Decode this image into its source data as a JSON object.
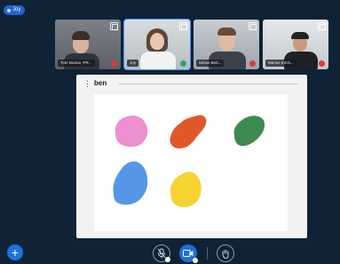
{
  "self_badge": {
    "label": "Joy"
  },
  "participants": [
    {
      "name": "Tom Dunne, PR...",
      "mic": "muted",
      "active": false
    },
    {
      "name": "Joy",
      "mic": "on",
      "active": true
    },
    {
      "name": "Niklas Berl...",
      "mic": "muted",
      "active": false
    },
    {
      "name": "Marius Kirch...",
      "mic": "muted",
      "active": false
    }
  ],
  "document": {
    "title": "ben",
    "menu_icon": "kebab-menu-icon",
    "shapes": [
      {
        "label": "pink blob",
        "color": "#ee8fd0"
      },
      {
        "label": "orange blob",
        "color": "#e2572a"
      },
      {
        "label": "green blob",
        "color": "#3c8a50"
      },
      {
        "label": "blue blob",
        "color": "#5597e6"
      },
      {
        "label": "yellow blob",
        "color": "#f6d331"
      }
    ]
  },
  "colors": {
    "background": "#0f2236",
    "accent": "#1f6fe0",
    "muted": "#d63c3c",
    "unmuted": "#2fa36b"
  },
  "controls": {
    "add_icon": "plus-icon",
    "mic_icon": "microphone-off-icon",
    "camera_icon": "video-camera-icon",
    "hand_icon": "raise-hand-icon"
  }
}
